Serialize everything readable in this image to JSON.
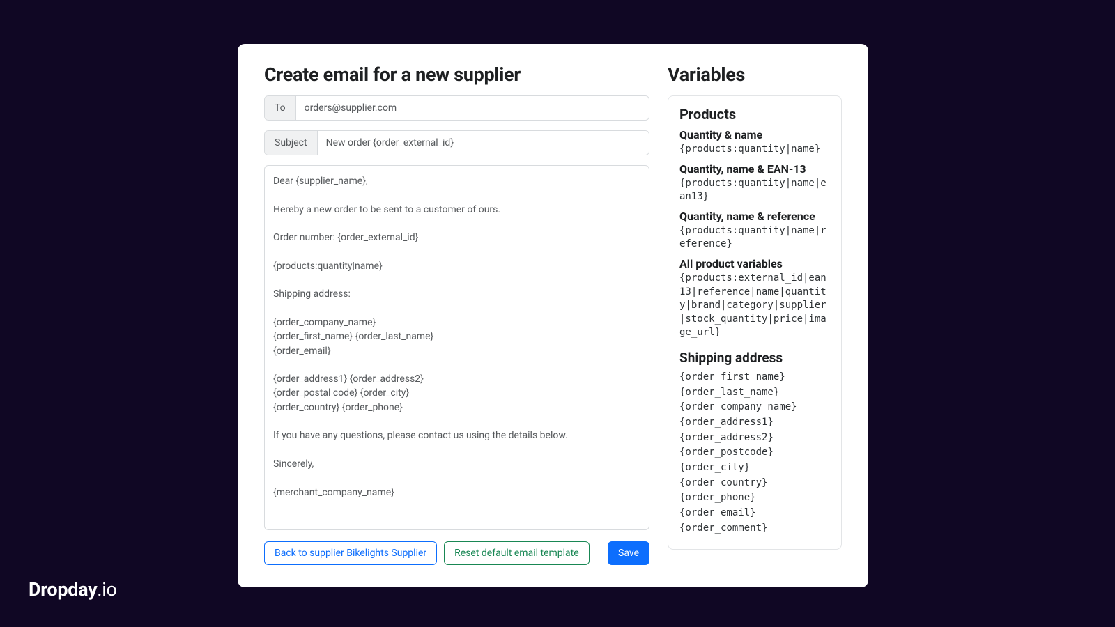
{
  "left": {
    "title": "Create email for a new supplier",
    "to_label": "To",
    "to_value": "orders@supplier.com",
    "subject_label": "Subject",
    "subject_value": "New order {order_external_id}",
    "body": "Dear {supplier_name},\n\nHereby a new order to be sent to a customer of ours.\n\nOrder number: {order_external_id}\n\n{products:quantity|name}\n\nShipping address:\n\n{order_company_name}\n{order_first_name} {order_last_name}\n{order_email}\n\n{order_address1} {order_address2}\n{order_postal code} {order_city}\n{order_country} {order_phone}\n\nIf you have any questions, please contact us using the details below.\n\nSincerely,\n\n{merchant_company_name}",
    "back_label": "Back to supplier Bikelights Supplier",
    "reset_label": "Reset default email template",
    "save_label": "Save"
  },
  "right": {
    "title": "Variables",
    "products_title": "Products",
    "groups": [
      {
        "label": "Quantity & name",
        "code": "{products:quantity|name}"
      },
      {
        "label": "Quantity, name & EAN-13",
        "code": "{products:quantity|name|ean13}"
      },
      {
        "label": "Quantity, name & reference",
        "code": "{products:quantity|name|reference}"
      },
      {
        "label": "All product variables",
        "code": "{products:external_id|ean13|reference|name|quantity|brand|category|supplier|stock_quantity|price|image_url}"
      }
    ],
    "shipping_title": "Shipping address",
    "shipping_vars": "{order_first_name}\n{order_last_name}\n{order_company_name}\n{order_address1}\n{order_address2}\n{order_postcode}\n{order_city}\n{order_country}\n{order_phone}\n{order_email}\n{order_comment}"
  },
  "brand": {
    "bold": "Dropday",
    "thin": ".io"
  }
}
